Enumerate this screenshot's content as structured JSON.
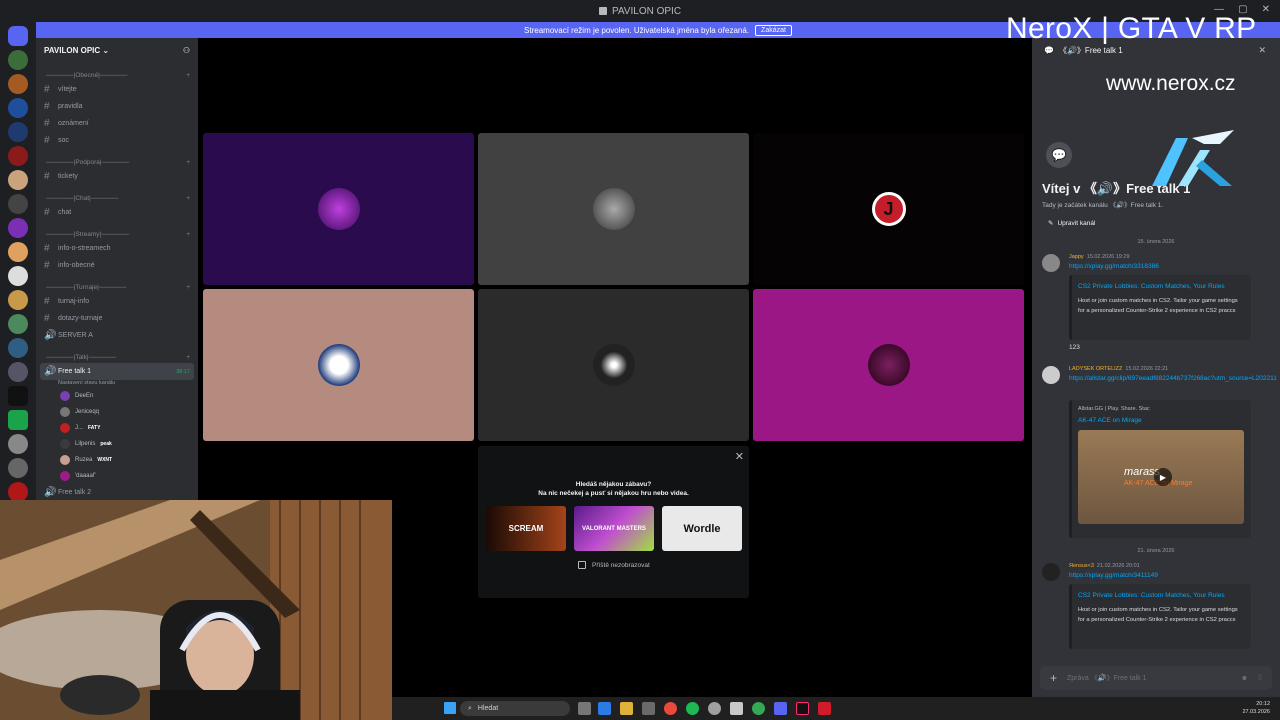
{
  "window": {
    "title": "PAVILON OPIC",
    "controls": [
      "—",
      "▢",
      "✕"
    ]
  },
  "banner": {
    "text": "Streamovací režim je povolen. Uživatelská jména byla ořezaná.",
    "button": "Zakázat"
  },
  "guild": {
    "name": "PAVILON OPIC"
  },
  "sidebar": {
    "categories": [
      {
        "label": "──────|Obecné|──────",
        "channels": [
          {
            "label": "vítejte"
          },
          {
            "label": "pravidla"
          },
          {
            "label": "oznámení"
          },
          {
            "label": "soc"
          }
        ]
      },
      {
        "label": "──────|Podpora|──────",
        "channels": [
          {
            "label": "tickety"
          }
        ]
      },
      {
        "label": "──────|Chat|──────",
        "channels": [
          {
            "label": "chat"
          }
        ]
      },
      {
        "label": "──────|Streamy|──────",
        "channels": [
          {
            "label": "info-o-streamech"
          },
          {
            "label": "info-obecné"
          }
        ]
      },
      {
        "label": "──────|Turnaje|──────",
        "channels": [
          {
            "label": "turnaj-info"
          },
          {
            "label": "dotazy-turnaje"
          },
          {
            "label": "SERVER A"
          }
        ]
      },
      {
        "label": "──────|Talk|──────"
      }
    ],
    "voice_channel": {
      "label": "Free talk 1",
      "timer": "38:17",
      "sublabel": "Nastavení stavu kanálu"
    },
    "voice_users": [
      {
        "name": "DeeEn",
        "tag": ""
      },
      {
        "name": "Jeniceqq",
        "tag": ""
      },
      {
        "name": "J...",
        "tag": "FATY"
      },
      {
        "name": "Lilpenis",
        "tag": "peak"
      },
      {
        "name": "Ruzea",
        "tag": "WXNT"
      },
      {
        "name": "'daaaaf'",
        "tag": ""
      }
    ],
    "next_voice": "Free talk 2"
  },
  "activity_popup": {
    "line1": "Hledáš nějakou zábavu?",
    "line2": "Na nic nečekej a pusť si nějakou hru nebo videa.",
    "games": [
      "SCREAM",
      "VALORANT MASTERS",
      "Wordle"
    ],
    "checkbox_label": "Příště nezobrazovat"
  },
  "chat": {
    "header": "《🔊》Free talk 1",
    "welcome_title": "Vítej v 《🔊》Free talk 1",
    "welcome_sub": "Tady je začátek kanálu 《🔊》Free talk 1.",
    "edit_button": "Upravit kanál",
    "date1": "15. února 2026",
    "date2": "21. února 2026",
    "messages": [
      {
        "author": "Jappy",
        "time": "15.02.2026 19:29",
        "link": "https://xplay.gg/match/3318386",
        "embed_title": "CS2 Private Lobbies: Custom Matches, Your Rules",
        "embed_desc": "Host or join custom matches in CS2. Tailor your game settings for a personalized Counter-Strike 2 experience in CS2 praccs"
      },
      {
        "text": "123"
      },
      {
        "author": "LADYSEK ORTELIZZ",
        "time": "15.02.2026 22:21",
        "link": "https://allstar.gg/clip/697eeadf882244b737f268ac?utm_source=L202211",
        "embed_provider": "Allstar.GG | Play. Share. Stac",
        "embed_title": "AK-47 ACE on Mirage",
        "thumb_title": "marass",
        "thumb_sub": "AK-47 ACE on Mirage"
      },
      {
        "author": "Яеnsus<3",
        "time": "21.02.2026 20:01",
        "link": "https://xplay.gg/match/3411149",
        "embed_title": "CS2 Private Lobbies: Custom Matches, Your Rules",
        "embed_desc": "Host or join custom matches in CS2. Tailor your game settings for a personalized Counter-Strike 2 experience in CS2 praccs"
      }
    ],
    "composer_placeholder": "Zpráva 《🔊》Free talk 1"
  },
  "overlay": {
    "title": "NeroX | GTA V RP",
    "url": "www.nerox.cz"
  },
  "taskbar": {
    "search": "Hledat",
    "time": "20:12",
    "date": "27.03.2026"
  },
  "colors": {
    "accent": "#5865f2",
    "link": "#00a8fc",
    "tile_purple": "#2a0b4e",
    "tile_pink": "#9b1786",
    "tile_tan": "#b58b80"
  }
}
